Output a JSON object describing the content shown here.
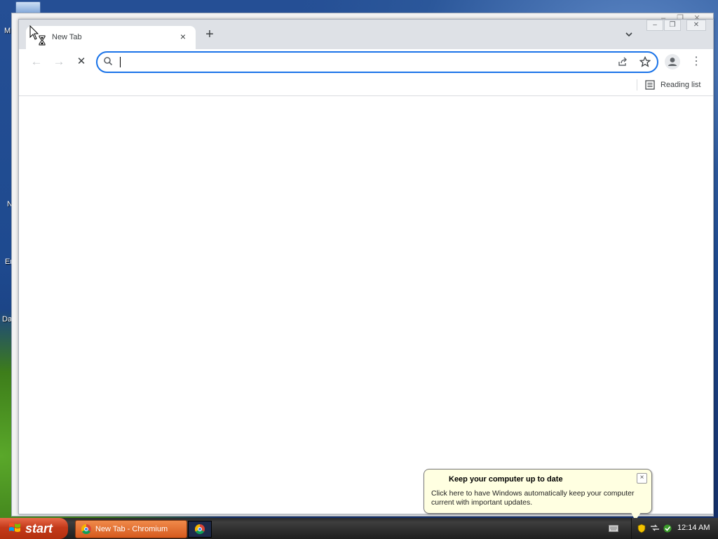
{
  "desktop": {
    "labels": [
      "M",
      "N",
      "Er",
      "Da"
    ]
  },
  "browser": {
    "tab": {
      "title": "New Tab",
      "close": "×"
    },
    "new_tab": "+",
    "tab_search": "⌄",
    "nav": {
      "back": "←",
      "forward": "→",
      "stop": "✕"
    },
    "omnibox": {
      "value": "",
      "placeholder": ""
    },
    "menu": "⋮",
    "reading_list": "Reading list",
    "window_controls": {
      "minimize": "–",
      "restore": "❐",
      "close": "✕"
    }
  },
  "balloon": {
    "title": "Keep your computer up to date",
    "body": "Click here to have Windows automatically keep your computer current with important updates.",
    "close": "×"
  },
  "taskbar": {
    "start": "start",
    "task_button": "New Tab - Chromium",
    "clock": "12:14 AM"
  },
  "colors": {
    "accent": "#1a73e8",
    "tabstrip": "#dee1e6",
    "start": "#c43a1a",
    "balloon": "#ffffe1"
  }
}
